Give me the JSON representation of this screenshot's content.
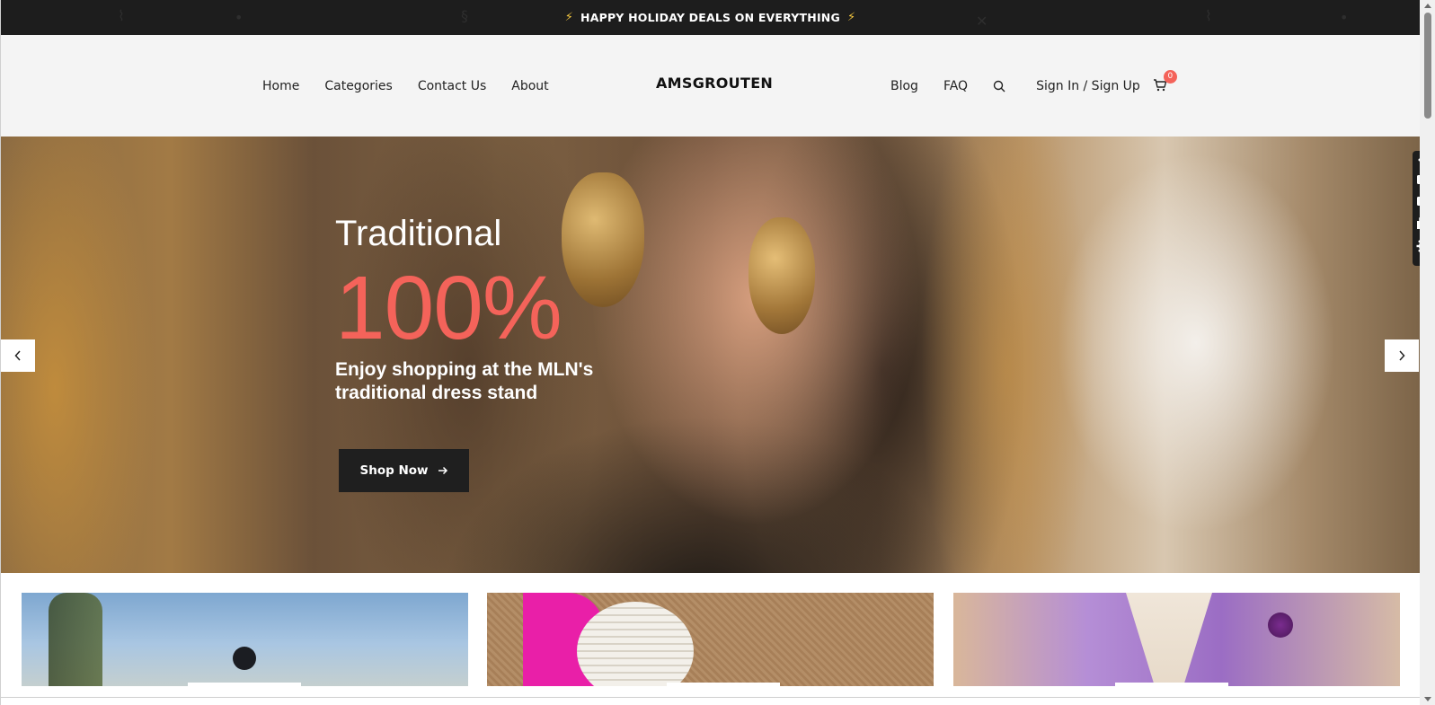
{
  "announcement": {
    "text": "HAPPY HOLIDAY DEALS ON EVERYTHING",
    "icon": "lightning-icon",
    "accent_color": "#f3c63f"
  },
  "header": {
    "logo": "AMSGROUTEN",
    "nav_left": [
      "Home",
      "Categories",
      "Contact Us",
      "About"
    ],
    "nav_right": [
      "Blog",
      "FAQ"
    ],
    "signin": "Sign In / Sign Up",
    "cart_count": "0"
  },
  "hero": {
    "eyebrow": "Traditional",
    "percent": "100%",
    "subtitle": "Enjoy shopping at the MLN's traditional dress stand",
    "cta": "Shop Now",
    "accent_color": "#f4635a"
  },
  "cards": [
    {
      "name": "category-card-1"
    },
    {
      "name": "category-card-2"
    },
    {
      "name": "category-card-3"
    }
  ],
  "side_tools": [
    "camera-icon",
    "video-icon",
    "window-icon",
    "gear-icon"
  ]
}
